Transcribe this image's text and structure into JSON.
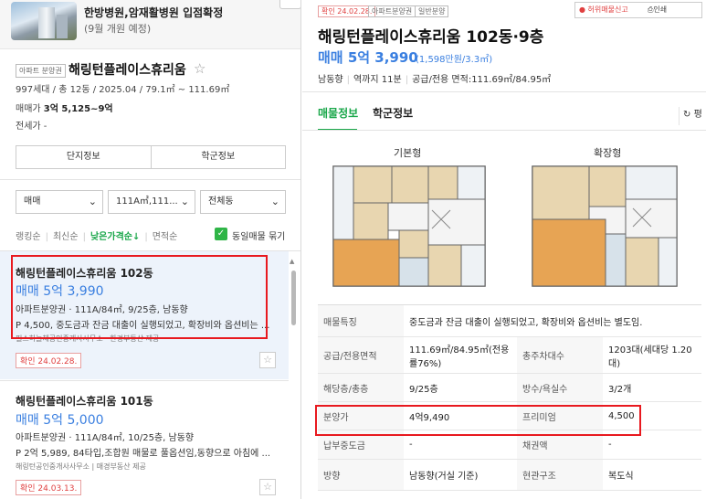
{
  "banner": {
    "title": "한방병원,암재활병원 입점확정",
    "subtitle": "(9월 개원 예정)"
  },
  "complex": {
    "tag": "아파트 분양권",
    "name": "해링턴플레이스휴리움",
    "info": "997세대 / 총 12동 / 2025.04 / 79.1㎡ ~ 111.69㎡",
    "price_label": "매매가",
    "price_value": "3억 5,125~9억",
    "jeonse": "전세가 -",
    "tabs": [
      "단지정보",
      "학군정보"
    ]
  },
  "filters": {
    "type": "매매",
    "area": "111A㎡,111...",
    "dong": "전체동"
  },
  "sort": {
    "items": [
      "랭킹순",
      "최신순",
      "낮은가격순↓",
      "면적순"
    ],
    "active_index": 2,
    "dup_label": "동일매물 묶기"
  },
  "listings": [
    {
      "name": "해링턴플레이스휴리움 102동",
      "price": "매매 5억 3,990",
      "meta": "아파트분양권 · 111A/84㎡, 9/25층, 남동향",
      "desc": "P 4,500, 중도금과 잔금 대출이 실행되었고, 확장비와 옵션비는 ...",
      "agent": "필스하늘채공인중개사사무소 · 한경부동산 제공",
      "confirmed": "확인 24.02.28."
    },
    {
      "name": "해링턴플레이스휴리움 101동",
      "price": "매매 5억 5,000",
      "meta": "아파트분양권 · 111A/84㎡, 10/25층, 남동향",
      "desc": "P 2억 5,989, 84타입,조합원 매물로 풀옵션임,동향으로 아침에 ...",
      "agent": "해링턴공인중개사사무소 | 매경부동산 제공",
      "confirmed": "확인 24.03.13."
    }
  ],
  "detail": {
    "badges": [
      "확인 24.02.28.",
      "아파트분양권",
      "일반분양"
    ],
    "report": "허위매물신고",
    "print": "인쇄",
    "title": "해링턴플레이스휴리움 102동·9층",
    "price": "매매 5억 3,990",
    "price_per": "(1,598만원/3.3㎡)",
    "summary": [
      "남동향",
      "역까지 11분",
      "공급/전용 면적:111.69㎡/84.95㎡"
    ],
    "tabs": [
      "매물정보",
      "학군정보"
    ],
    "refresh": "평",
    "floorplans": [
      "기본형",
      "확장형"
    ],
    "rows": {
      "feature_label": "매물특징",
      "feature_value": "중도금과 잔금 대출이 실행되었고, 확장비와 옵션비는 별도임.",
      "area_label": "공급/전용면적",
      "area_value": "111.69㎡/84.95㎡(전용률76%)",
      "households_label": "총주차대수",
      "households_value": "1203대(세대당 1.20대)",
      "floor_label": "해당층/총층",
      "floor_value": "9/25층",
      "rooms_label": "방수/욕실수",
      "rooms_value": "3/2개",
      "presale_label": "분양가",
      "presale_value": "4억9,490",
      "premium_label": "프리미엄",
      "premium_value": "4,500",
      "deposit_label": "납부중도금",
      "deposit_value": "-",
      "debt_label": "채권액",
      "debt_value": "-",
      "dir_label": "방향",
      "dir_value": "남동향(거실 기준)",
      "struct_label": "현관구조",
      "struct_value": "복도식"
    }
  },
  "colors": {
    "accent_green": "#1aa74a",
    "price_blue": "#3a7fe0",
    "highlight_red": "#e8191f",
    "selected_bg": "#edf3fb"
  }
}
